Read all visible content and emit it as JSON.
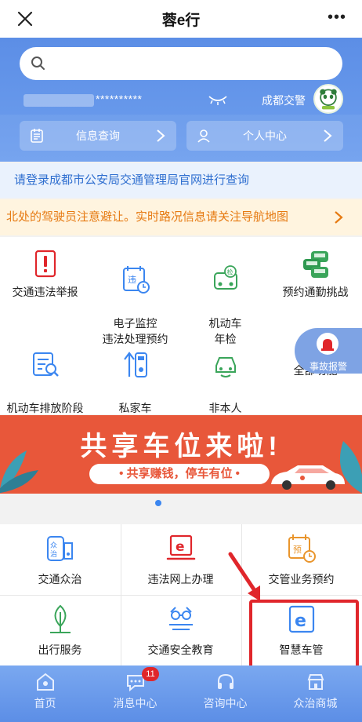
{
  "app": {
    "title": "蓉e行"
  },
  "search": {
    "placeholder": ""
  },
  "account": {
    "masked_number": "**********",
    "organization": "成都交警"
  },
  "hero_buttons": {
    "info_query": "信息查询",
    "personal_center": "个人中心"
  },
  "login_tip": "请登录成都市公安局交通管理局官网进行查询",
  "notice": "北处的驾驶员注意避让。实时路况信息请关注导航地图",
  "grid": [
    {
      "label": "交通违法举报",
      "icon": "violation-report-icon"
    },
    {
      "label": "电子监控\n违法处理预约",
      "icon": "camera-appointment-icon"
    },
    {
      "label": "机动车\n年检",
      "icon": "annual-inspection-icon"
    },
    {
      "label": "预约通勤挑战",
      "icon": "commute-challenge-icon"
    },
    {
      "label": "机动车排放阶段\n查询",
      "icon": "emission-query-icon"
    },
    {
      "label": "私家车\n停驶申报",
      "icon": "parking-declare-icon"
    },
    {
      "label": "非本人\n车辆绑定",
      "icon": "vehicle-bind-icon"
    },
    {
      "label": "全部功能",
      "icon": "all-functions-icon"
    }
  ],
  "float_report": {
    "label": "事故报警"
  },
  "banner": {
    "title": "共享车位来啦!",
    "subtitle": "• 共享赚钱，停车有位 •"
  },
  "services": [
    {
      "label": "交通众治",
      "icon": "crowd-governance-icon"
    },
    {
      "label": "违法网上办理",
      "icon": "online-violation-icon"
    },
    {
      "label": "交管业务预约",
      "icon": "business-appointment-icon"
    },
    {
      "label": "出行服务",
      "icon": "travel-service-icon"
    },
    {
      "label": "交通安全教育",
      "icon": "safety-education-icon"
    },
    {
      "label": "智慧车管",
      "icon": "smart-vehicle-icon"
    }
  ],
  "nav": [
    {
      "label": "首页",
      "icon": "home-icon"
    },
    {
      "label": "消息中心",
      "icon": "message-icon",
      "badge": "11"
    },
    {
      "label": "咨询中心",
      "icon": "headset-icon"
    },
    {
      "label": "众治商城",
      "icon": "shop-icon"
    }
  ],
  "colors": {
    "primary": "#5c8ee6",
    "notice_text": "#e67a12",
    "link": "#2f6fd0",
    "icon_red": "#e0262b",
    "icon_blue": "#3b86f0",
    "icon_green": "#3aa55a",
    "icon_orange": "#e9952c",
    "banner": "#e8573a"
  }
}
